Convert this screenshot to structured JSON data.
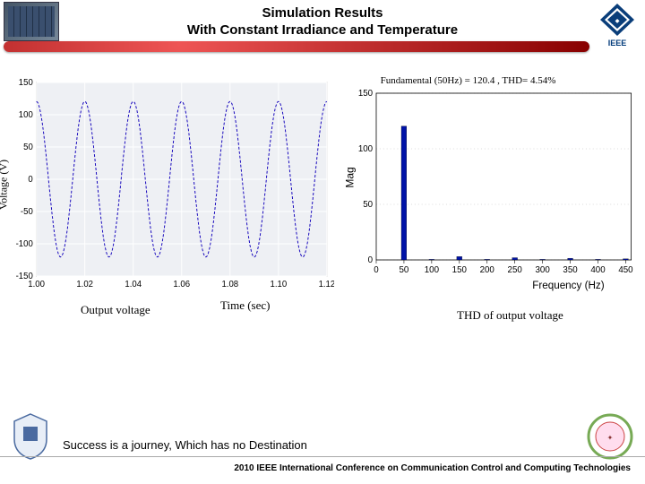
{
  "header": {
    "title_line1": "Simulation Results",
    "title_line2": "With Constant Irradiance and Temperature",
    "ieee_label": "IEEE"
  },
  "left_chart": {
    "ylabel": "Voltage (V)",
    "caption": "Output voltage",
    "xlabel_caption": "Time (sec)"
  },
  "right_chart": {
    "title": "Fundamental (50Hz) = 120.4 , THD= 4.54%",
    "ylabel": "Mag",
    "xlabel": "Frequency (Hz)",
    "caption": "THD of output voltage"
  },
  "footer": {
    "quote": "Success is a journey, Which has no Destination",
    "conference": "2010 IEEE International Conference on Communication Control and Computing Technologies"
  },
  "chart_data": [
    {
      "type": "line",
      "title": "Output voltage",
      "xlabel": "Time (sec)",
      "ylabel": "Voltage (V)",
      "xlim": [
        1.0,
        1.12
      ],
      "ylim": [
        -150,
        150
      ],
      "x_ticks": [
        1.0,
        1.02,
        1.04,
        1.06,
        1.08,
        1.1,
        1.12
      ],
      "y_ticks": [
        -150,
        -100,
        -50,
        0,
        50,
        100,
        150
      ],
      "series": [
        {
          "name": "Output voltage",
          "fundamental_amplitude": 120.4,
          "frequency_hz": 50,
          "phase_deg": 90,
          "note": "sinusoidal, ~6 full cycles over 0.12 s window"
        }
      ]
    },
    {
      "type": "bar",
      "title": "Fundamental (50Hz) = 120.4 , THD= 4.54%",
      "xlabel": "Frequency (Hz)",
      "ylabel": "Mag",
      "xlim": [
        0,
        460
      ],
      "ylim": [
        0,
        150
      ],
      "x_ticks": [
        0,
        50,
        100,
        150,
        200,
        250,
        300,
        350,
        400,
        450
      ],
      "y_ticks": [
        0,
        50,
        100,
        150
      ],
      "categories": [
        50,
        100,
        150,
        200,
        250,
        300,
        350,
        400,
        450
      ],
      "values": [
        120.4,
        0.5,
        3,
        0.5,
        2,
        0.5,
        1.5,
        0.5,
        1
      ]
    }
  ]
}
